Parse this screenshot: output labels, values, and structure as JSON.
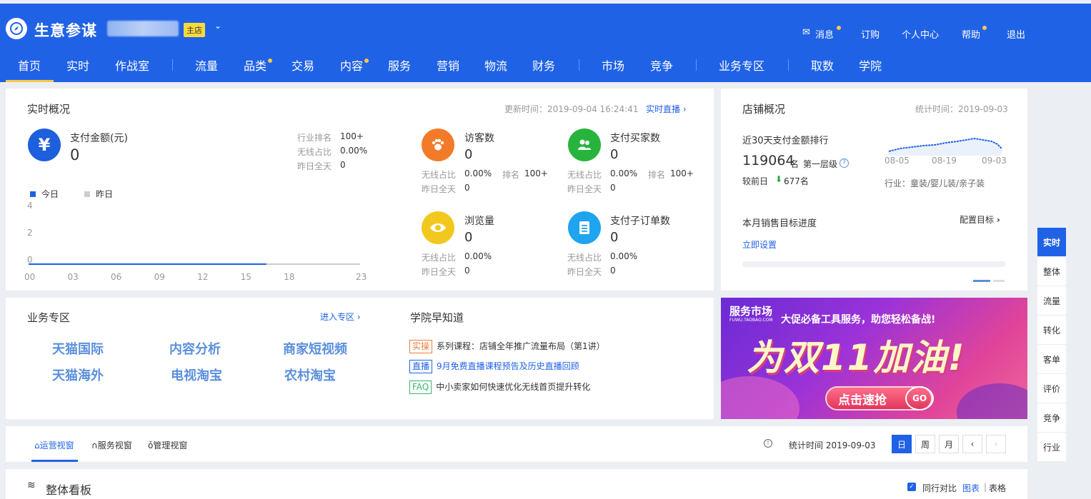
{
  "header": {
    "app_title": "生意参谋",
    "store_badge": "主店",
    "top_links": [
      "消息",
      "订购",
      "个人中心",
      "帮助",
      "退出"
    ],
    "nav": [
      "首页",
      "实时",
      "作战室",
      "流量",
      "品类",
      "交易",
      "内容",
      "服务",
      "营销",
      "物流",
      "财务",
      "市场",
      "竞争",
      "业务专区",
      "取数",
      "学院"
    ]
  },
  "realtime": {
    "title": "实时概况",
    "update_label": "更新时间：2019-09-04 16:24:41",
    "live_link": "实时直播",
    "pay": {
      "label": "支付金额(元)",
      "value": "0",
      "rank_label": "行业排名",
      "rank_value": "100+",
      "wireless_label": "无线占比",
      "wireless_value": "0.00%",
      "yesterday_label": "昨日全天",
      "yesterday_value": "0"
    },
    "legend": {
      "today": "今日",
      "yesterday": "昨日"
    },
    "metrics": [
      {
        "label": "访客数",
        "value": "0",
        "wireless_label": "无线占比",
        "wireless": "0.00%",
        "rank_label": "排名",
        "rank": "100+",
        "yesterday_label": "昨日全天",
        "yesterday": "0"
      },
      {
        "label": "支付买家数",
        "value": "0",
        "wireless_label": "无线占比",
        "wireless": "0.00%",
        "rank_label": "排名",
        "rank": "100+",
        "yesterday_label": "昨日全天",
        "yesterday": "0"
      },
      {
        "label": "浏览量",
        "value": "0",
        "wireless_label": "无线占比",
        "wireless": "0.00%",
        "yesterday_label": "昨日全天",
        "yesterday": "0"
      },
      {
        "label": "支付子订单数",
        "value": "0",
        "wireless_label": "无线占比",
        "wireless": "0.00%",
        "yesterday_label": "昨日全天",
        "yesterday": "0"
      }
    ]
  },
  "chart_data": {
    "type": "line",
    "x_ticks": [
      "00",
      "03",
      "06",
      "09",
      "12",
      "15",
      "18",
      "23"
    ],
    "y_ticks": [
      "4",
      "2",
      "0"
    ],
    "ylim": [
      0,
      4
    ],
    "series": [
      {
        "name": "今日",
        "color": "#2062e6",
        "points": [
          [
            0,
            0
          ],
          [
            16.5,
            0
          ]
        ]
      },
      {
        "name": "昨日",
        "color": "#cccccc",
        "points": [
          [
            0,
            0
          ],
          [
            23,
            0
          ]
        ]
      }
    ]
  },
  "shop": {
    "title": "店铺概况",
    "stat_time": "统计时间：2019-09-03",
    "rank_title": "近30天支付金额排行",
    "rank_value": "119064",
    "rank_unit": "名",
    "level": "第一层级",
    "compare_label": "较前日",
    "compare_value": "677名",
    "spark_labels": [
      "08-05",
      "08-19",
      "09-03"
    ],
    "industry": "行业：童装/婴儿装/亲子装",
    "target_title": "本月销售目标进度",
    "config_link": "配置目标",
    "set_link": "立即设置"
  },
  "business": {
    "title": "业务专区",
    "enter_link": "进入专区",
    "links": [
      "天猫国际",
      "内容分析",
      "商家短视频",
      "天猫海外",
      "电视淘宝",
      "农村淘宝"
    ]
  },
  "academy": {
    "title": "学院早知道",
    "items": [
      {
        "tag": "实操",
        "text": "系列课程：店铺全年推广流量布局（第1讲）",
        "color": "#ef7d3c"
      },
      {
        "tag": "直播",
        "text": "9月免费直播课程预告及历史直播回顾",
        "color": "#2062e6"
      },
      {
        "tag": "FAQ",
        "text": "中小卖家如何快速优化无线首页提升转化",
        "color": "#3cb371"
      }
    ]
  },
  "banner": {
    "brand": "服务市场",
    "brand_sub": "FUWU.TAOBAO.COM",
    "headline": "大促必备工具服务，助您轻松备战!",
    "slogan": "为双11加油!",
    "cta": "点击速抢",
    "go": "GO"
  },
  "side_tabs": [
    "实时",
    "整体",
    "流量",
    "转化",
    "客单",
    "评价",
    "竞争",
    "行业"
  ],
  "view_tabs": {
    "tabs": [
      "运营视窗",
      "服务视窗",
      "管理视窗"
    ],
    "stat_time": "统计时间 2019-09-03",
    "periods": [
      "日",
      "周",
      "月"
    ]
  },
  "board": {
    "title": "整体看板",
    "compare": "同行对比",
    "chart_link": "图表",
    "table_link": "表格"
  }
}
